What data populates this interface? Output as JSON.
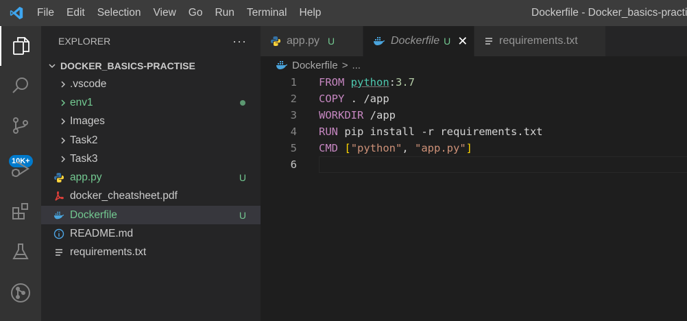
{
  "titlebar": {
    "menu": [
      "File",
      "Edit",
      "Selection",
      "View",
      "Go",
      "Run",
      "Terminal",
      "Help"
    ],
    "window_title": "Dockerfile - Docker_basics-practise"
  },
  "activitybar": {
    "items": [
      "explorer-icon",
      "search-icon",
      "source-control-icon",
      "run-debug-icon",
      "extensions-icon",
      "testing-icon",
      "git-graph-icon"
    ],
    "scm_badge": "10K+"
  },
  "explorer": {
    "title": "EXPLORER",
    "more": "···",
    "folder": "DOCKER_BASICS-PRACTISE",
    "items": [
      {
        "label": ".vscode",
        "type": "folder"
      },
      {
        "label": "env1",
        "type": "folder",
        "status": "dot"
      },
      {
        "label": "Images",
        "type": "folder"
      },
      {
        "label": "Task2",
        "type": "folder"
      },
      {
        "label": "Task3",
        "type": "folder"
      },
      {
        "label": "app.py",
        "type": "python",
        "status": "U"
      },
      {
        "label": "docker_cheatsheet.pdf",
        "type": "pdf"
      },
      {
        "label": "Dockerfile",
        "type": "docker",
        "status": "U",
        "selected": true
      },
      {
        "label": "README.md",
        "type": "info"
      },
      {
        "label": "requirements.txt",
        "type": "text"
      }
    ]
  },
  "tabs": [
    {
      "label": "app.py",
      "status": "U",
      "icon": "python-icon"
    },
    {
      "label": "Dockerfile",
      "status": "U",
      "icon": "docker-icon",
      "active": true
    },
    {
      "label": "requirements.txt",
      "icon": "text-file-icon"
    }
  ],
  "breadcrumb": {
    "file": "Dockerfile",
    "sep": ">",
    "rest": "..."
  },
  "editor": {
    "line_numbers": [
      "1",
      "2",
      "3",
      "4",
      "5",
      "6"
    ],
    "l1": {
      "kw": "FROM",
      "image": "python",
      "colon": ":",
      "tag": "3.7"
    },
    "l2": {
      "kw": "COPY",
      "rest": " . /app"
    },
    "l3": {
      "kw": "WORKDIR",
      "rest": " /app"
    },
    "l4": {
      "kw": "RUN",
      "rest": " pip install -r requirements.txt"
    },
    "l5": {
      "kw": "CMD",
      "open": "[",
      "a1": "\"python\"",
      "comma": ", ",
      "a2": "\"app.py\"",
      "close": "]"
    }
  },
  "colors": {
    "untracked": "#73c991",
    "keyword": "#c586c0",
    "string": "#ce9178",
    "accent": "#007acc"
  }
}
